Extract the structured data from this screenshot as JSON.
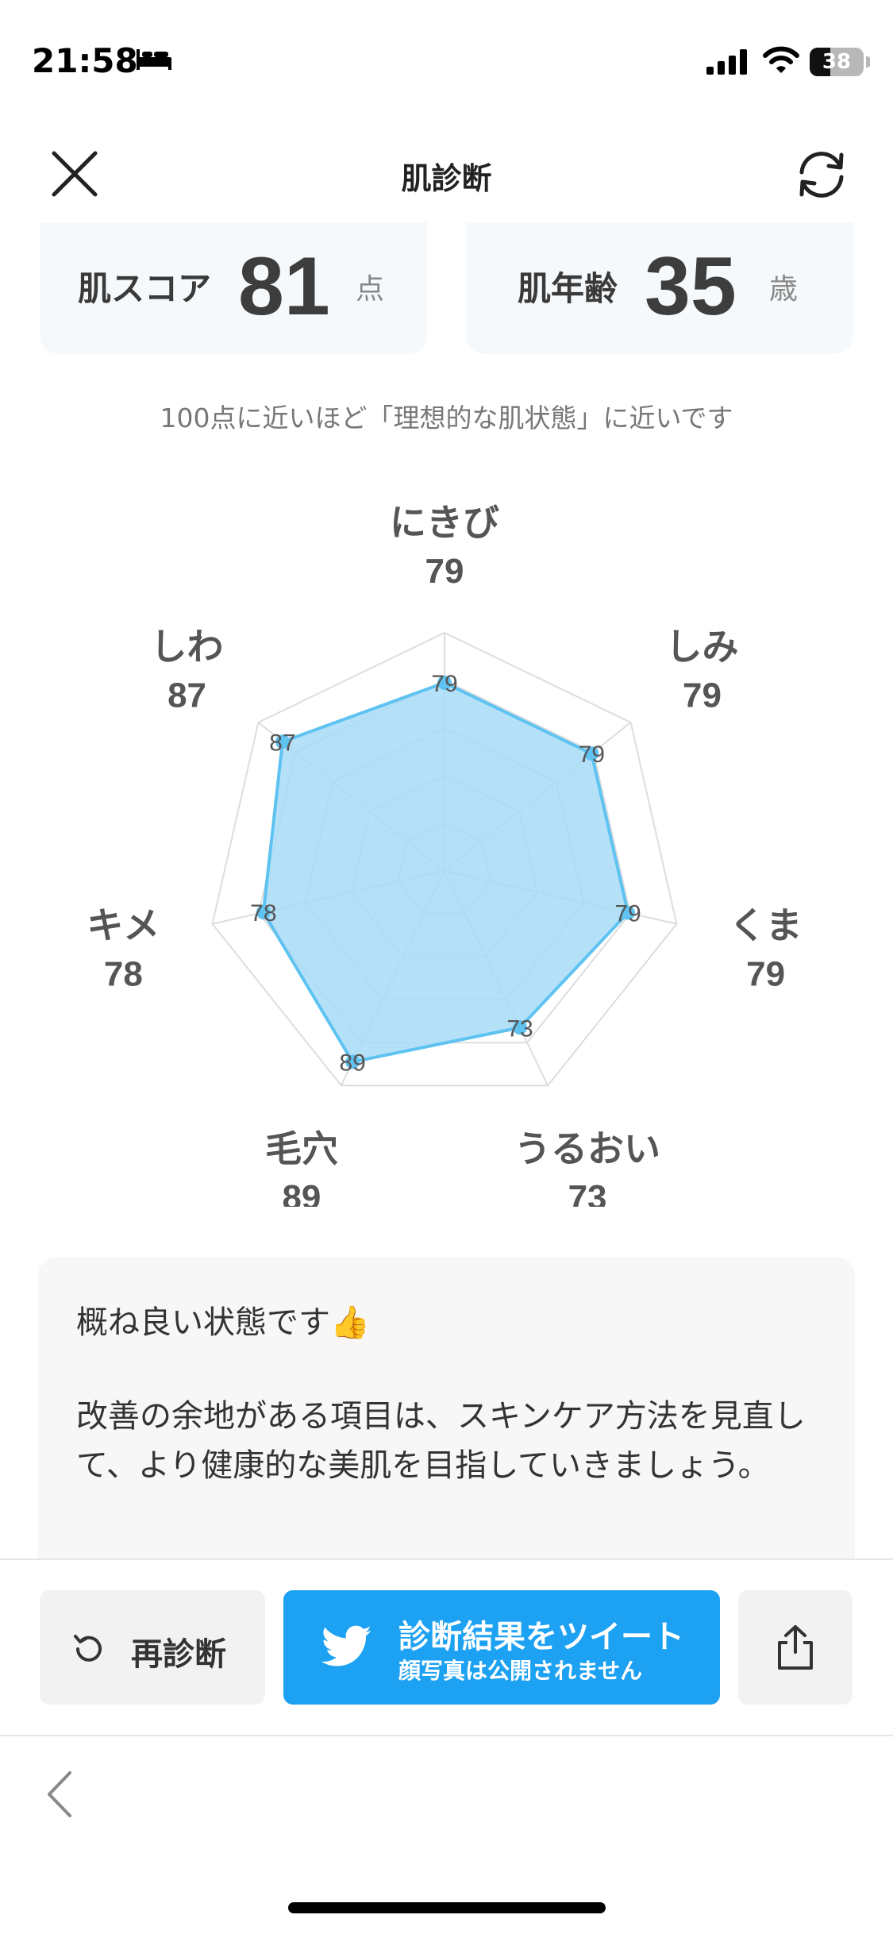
{
  "status_bar": {
    "time": "21:58",
    "battery": "38",
    "battery_level": 0.38
  },
  "header": {
    "title": "肌診断"
  },
  "scores": {
    "skin_score_label": "肌スコア",
    "skin_score_value": "81",
    "skin_score_unit": "点",
    "skin_age_label": "肌年齢",
    "skin_age_value": "35",
    "skin_age_unit": "歳"
  },
  "caption": "100点に近いほど「理想的な肌状態」に近いです",
  "chart_data": {
    "type": "radar",
    "max": 100,
    "rings": 5,
    "color": "#5fc3f2",
    "fill": "#a7dcf7",
    "categories": [
      "にきび",
      "しみ",
      "くま",
      "うるおい",
      "毛穴",
      "キメ",
      "しわ"
    ],
    "values": [
      79,
      79,
      79,
      73,
      89,
      78,
      87
    ]
  },
  "comment": {
    "line1": "概ね良い状態です👍",
    "line2": "改善の余地がある項目は、スキンケア方法を見直して、より健康的な美肌を目指していきましょう。"
  },
  "actions": {
    "rediagnose_label": "再診断",
    "tweet_label": "診断結果をツイート",
    "tweet_sub": "顔写真は公開されません",
    "twitter_color": "#1da1f2"
  }
}
